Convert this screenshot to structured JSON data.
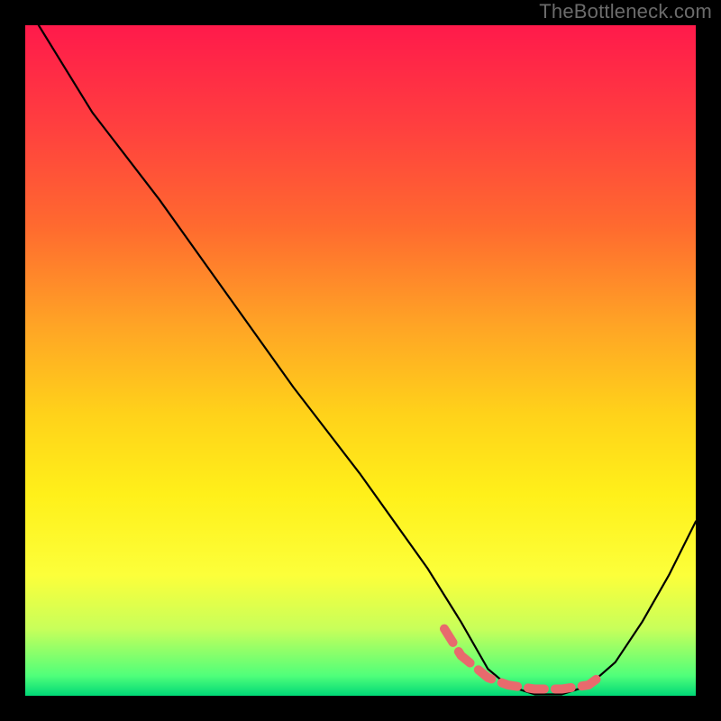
{
  "watermark": "TheBottleneck.com",
  "gradient": {
    "stops": [
      {
        "offset": 0.0,
        "color": "#ff1a4b"
      },
      {
        "offset": 0.15,
        "color": "#ff3f3f"
      },
      {
        "offset": 0.3,
        "color": "#ff6a2f"
      },
      {
        "offset": 0.45,
        "color": "#ffa525"
      },
      {
        "offset": 0.58,
        "color": "#ffd21a"
      },
      {
        "offset": 0.7,
        "color": "#fff01a"
      },
      {
        "offset": 0.82,
        "color": "#fcff3a"
      },
      {
        "offset": 0.9,
        "color": "#c8ff5a"
      },
      {
        "offset": 0.97,
        "color": "#50ff7a"
      },
      {
        "offset": 1.0,
        "color": "#00d877"
      }
    ]
  },
  "colors": {
    "curve": "#000000",
    "accent": "#e86a6d",
    "background": "#000000"
  },
  "chart_data": {
    "type": "line",
    "title": "",
    "xlabel": "",
    "ylabel": "",
    "xlim": [
      0,
      100
    ],
    "ylim": [
      0,
      100
    ],
    "series": [
      {
        "name": "bottleneck-curve",
        "x": [
          2,
          10,
          20,
          30,
          40,
          50,
          55,
          60,
          65,
          69,
          72,
          76,
          80,
          84,
          88,
          92,
          96,
          100
        ],
        "values": [
          100,
          87,
          74,
          60,
          46,
          33,
          26,
          19,
          11,
          4,
          1.5,
          0.2,
          0.2,
          1.5,
          5,
          11,
          18,
          26
        ]
      },
      {
        "name": "optimal-range-marker",
        "x": [
          62.5,
          65,
          69,
          72,
          76,
          80,
          84,
          85.5
        ],
        "values": [
          10,
          6,
          2.7,
          1.6,
          1.0,
          1.0,
          1.6,
          2.7
        ]
      }
    ],
    "annotations": []
  }
}
